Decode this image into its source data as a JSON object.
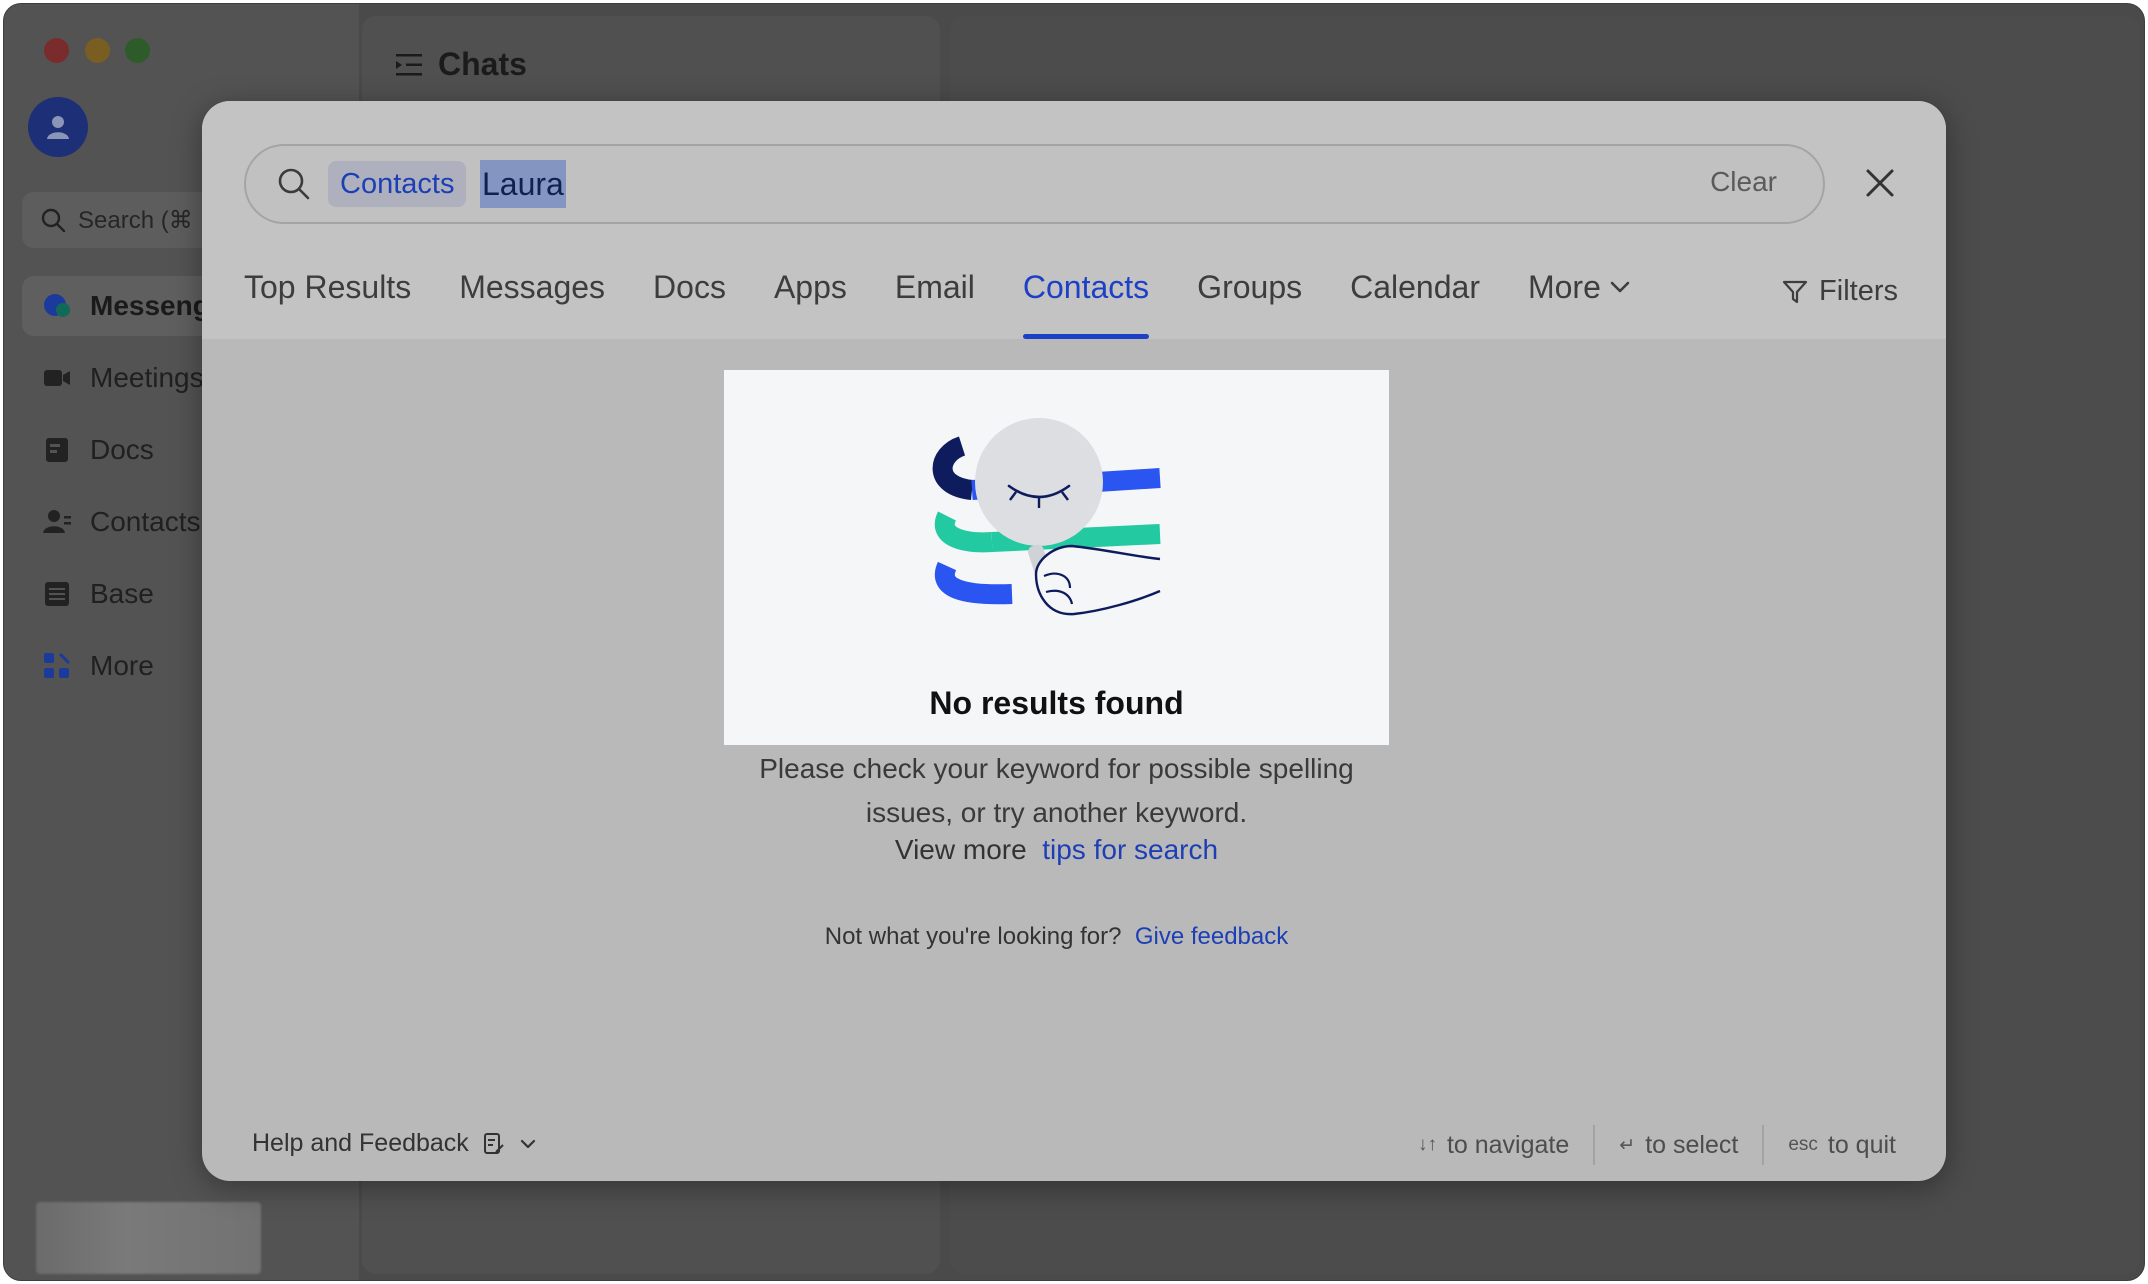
{
  "app": {
    "rail": {
      "search_placeholder": "Search (⌘",
      "items": [
        {
          "label": "Messeng",
          "icon": "messenger-icon",
          "active": true
        },
        {
          "label": "Meetings",
          "icon": "video-camera-icon",
          "active": false
        },
        {
          "label": "Docs",
          "icon": "docs-icon",
          "active": false
        },
        {
          "label": "Contacts",
          "icon": "contacts-icon",
          "active": false
        },
        {
          "label": "Base",
          "icon": "base-icon",
          "active": false
        },
        {
          "label": "More",
          "icon": "apps-grid-icon",
          "active": false
        }
      ]
    },
    "chats_title": "Chats"
  },
  "search": {
    "scope_chip": "Contacts",
    "query": "Laura",
    "clear_label": "Clear",
    "tabs": [
      {
        "label": "Top Results",
        "active": false
      },
      {
        "label": "Messages",
        "active": false
      },
      {
        "label": "Docs",
        "active": false
      },
      {
        "label": "Apps",
        "active": false
      },
      {
        "label": "Email",
        "active": false
      },
      {
        "label": "Contacts",
        "active": true
      },
      {
        "label": "Groups",
        "active": false
      },
      {
        "label": "Calendar",
        "active": false
      },
      {
        "label": "More",
        "active": false
      }
    ],
    "filters_label": "Filters"
  },
  "empty_state": {
    "title": "No results found",
    "description_line1": "Please check your keyword for possible spelling",
    "description_line2": "issues, or try another keyword.",
    "view_more_prefix": "View more",
    "tips_link": "tips for search",
    "feedback_prefix": "Not what you're looking for?",
    "feedback_link": "Give feedback"
  },
  "footer": {
    "help_label": "Help and Feedback",
    "hints": [
      {
        "key": "↓↑",
        "label": "to navigate"
      },
      {
        "key": "↵",
        "label": "to select"
      },
      {
        "key": "esc",
        "label": "to quit"
      }
    ]
  },
  "colors": {
    "accent": "#1e40c7",
    "illustration_blue": "#2a55f0",
    "illustration_green": "#22c9a1",
    "illustration_navy": "#0e1b5c"
  }
}
